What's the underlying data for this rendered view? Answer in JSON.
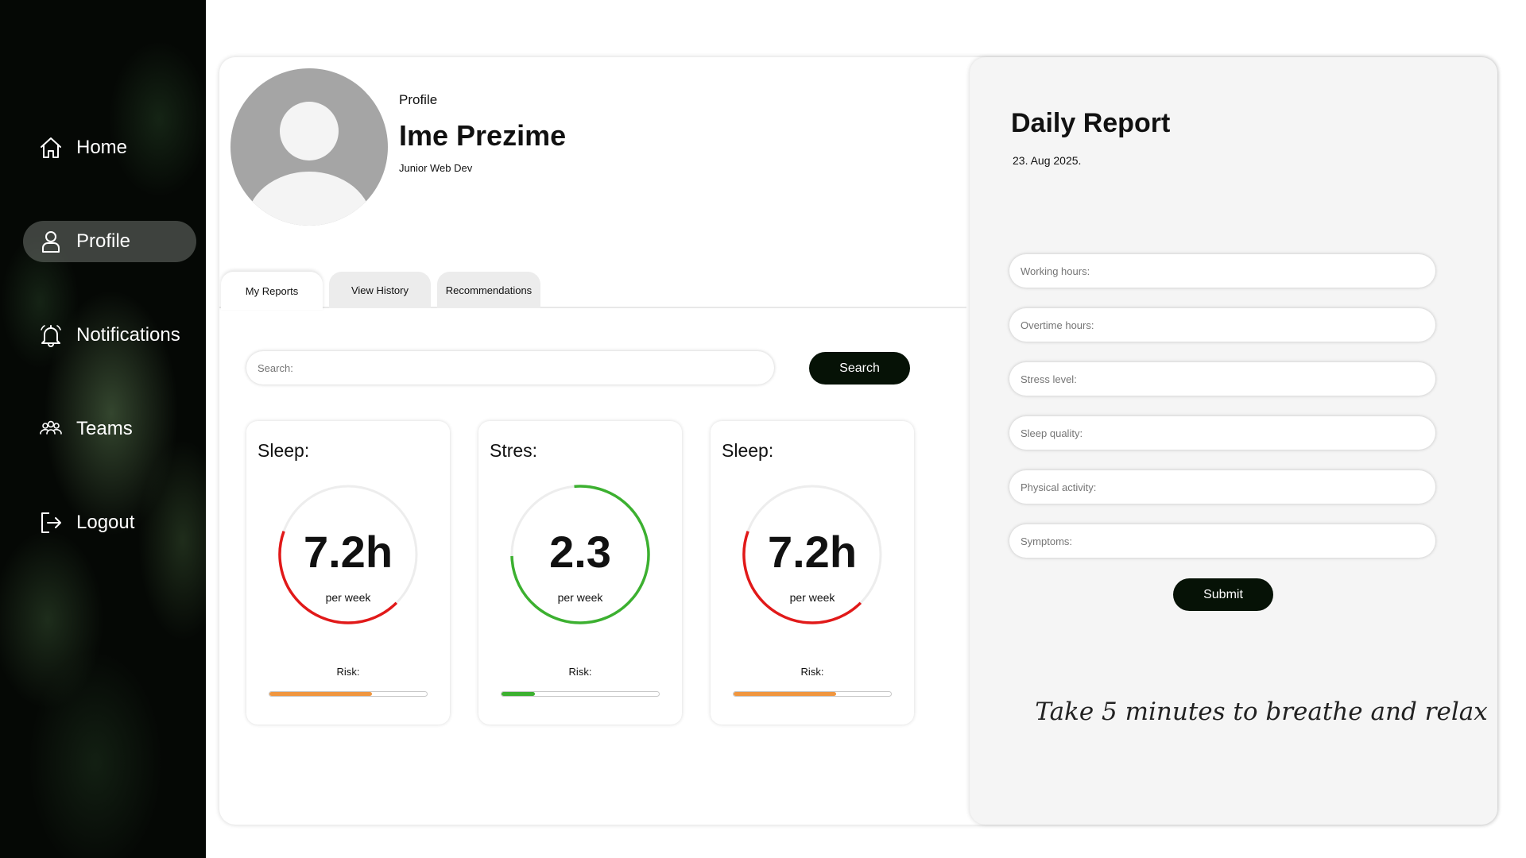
{
  "sidebar": {
    "items": [
      {
        "label": "Home",
        "icon": "home-icon",
        "active": false
      },
      {
        "label": "Profile",
        "icon": "user-icon",
        "active": true
      },
      {
        "label": "Notifications",
        "icon": "bell-icon",
        "active": false
      },
      {
        "label": "Teams",
        "icon": "team-icon",
        "active": false
      },
      {
        "label": "Logout",
        "icon": "logout-icon",
        "active": false
      }
    ]
  },
  "profile": {
    "section_label": "Profile",
    "name": "Ime Prezime",
    "role": "Junior Web Dev"
  },
  "tabs": [
    {
      "label": "My Reports",
      "active": true
    },
    {
      "label": "View History",
      "active": false
    },
    {
      "label": "Recommendations",
      "active": false
    }
  ],
  "search": {
    "placeholder": "Search:",
    "button_label": "Search"
  },
  "metrics": [
    {
      "title": "Sleep:",
      "value": "7.2h",
      "unit": "per week",
      "risk_label": "Risk:",
      "ring_fraction": 0.43,
      "ring_color": "#e11919",
      "risk_fraction": 0.65,
      "risk_color": "#f0963f"
    },
    {
      "title": "Stres:",
      "value": "2.3",
      "unit": "per week",
      "risk_label": "Risk:",
      "ring_fraction": 0.76,
      "ring_color": "#3cb030",
      "risk_fraction": 0.21,
      "risk_color": "#3cb030"
    },
    {
      "title": "Sleep:",
      "value": "7.2h",
      "unit": "per week",
      "risk_label": "Risk:",
      "ring_fraction": 0.43,
      "ring_color": "#e11919",
      "risk_fraction": 0.65,
      "risk_color": "#f0963f"
    }
  ],
  "report": {
    "title": "Daily Report",
    "date": "23. Aug 2025.",
    "fields": [
      {
        "placeholder": "Working hours:"
      },
      {
        "placeholder": "Overtime hours:"
      },
      {
        "placeholder": "Stress level:"
      },
      {
        "placeholder": "Sleep quality:"
      },
      {
        "placeholder": "Physical activity:"
      },
      {
        "placeholder": "Symptoms:"
      }
    ],
    "submit_label": "Submit",
    "quote": "Take 5 minutes to breathe and relax"
  },
  "colors": {
    "button_dark": "#061206",
    "sidebar_active": "#6e736e"
  }
}
